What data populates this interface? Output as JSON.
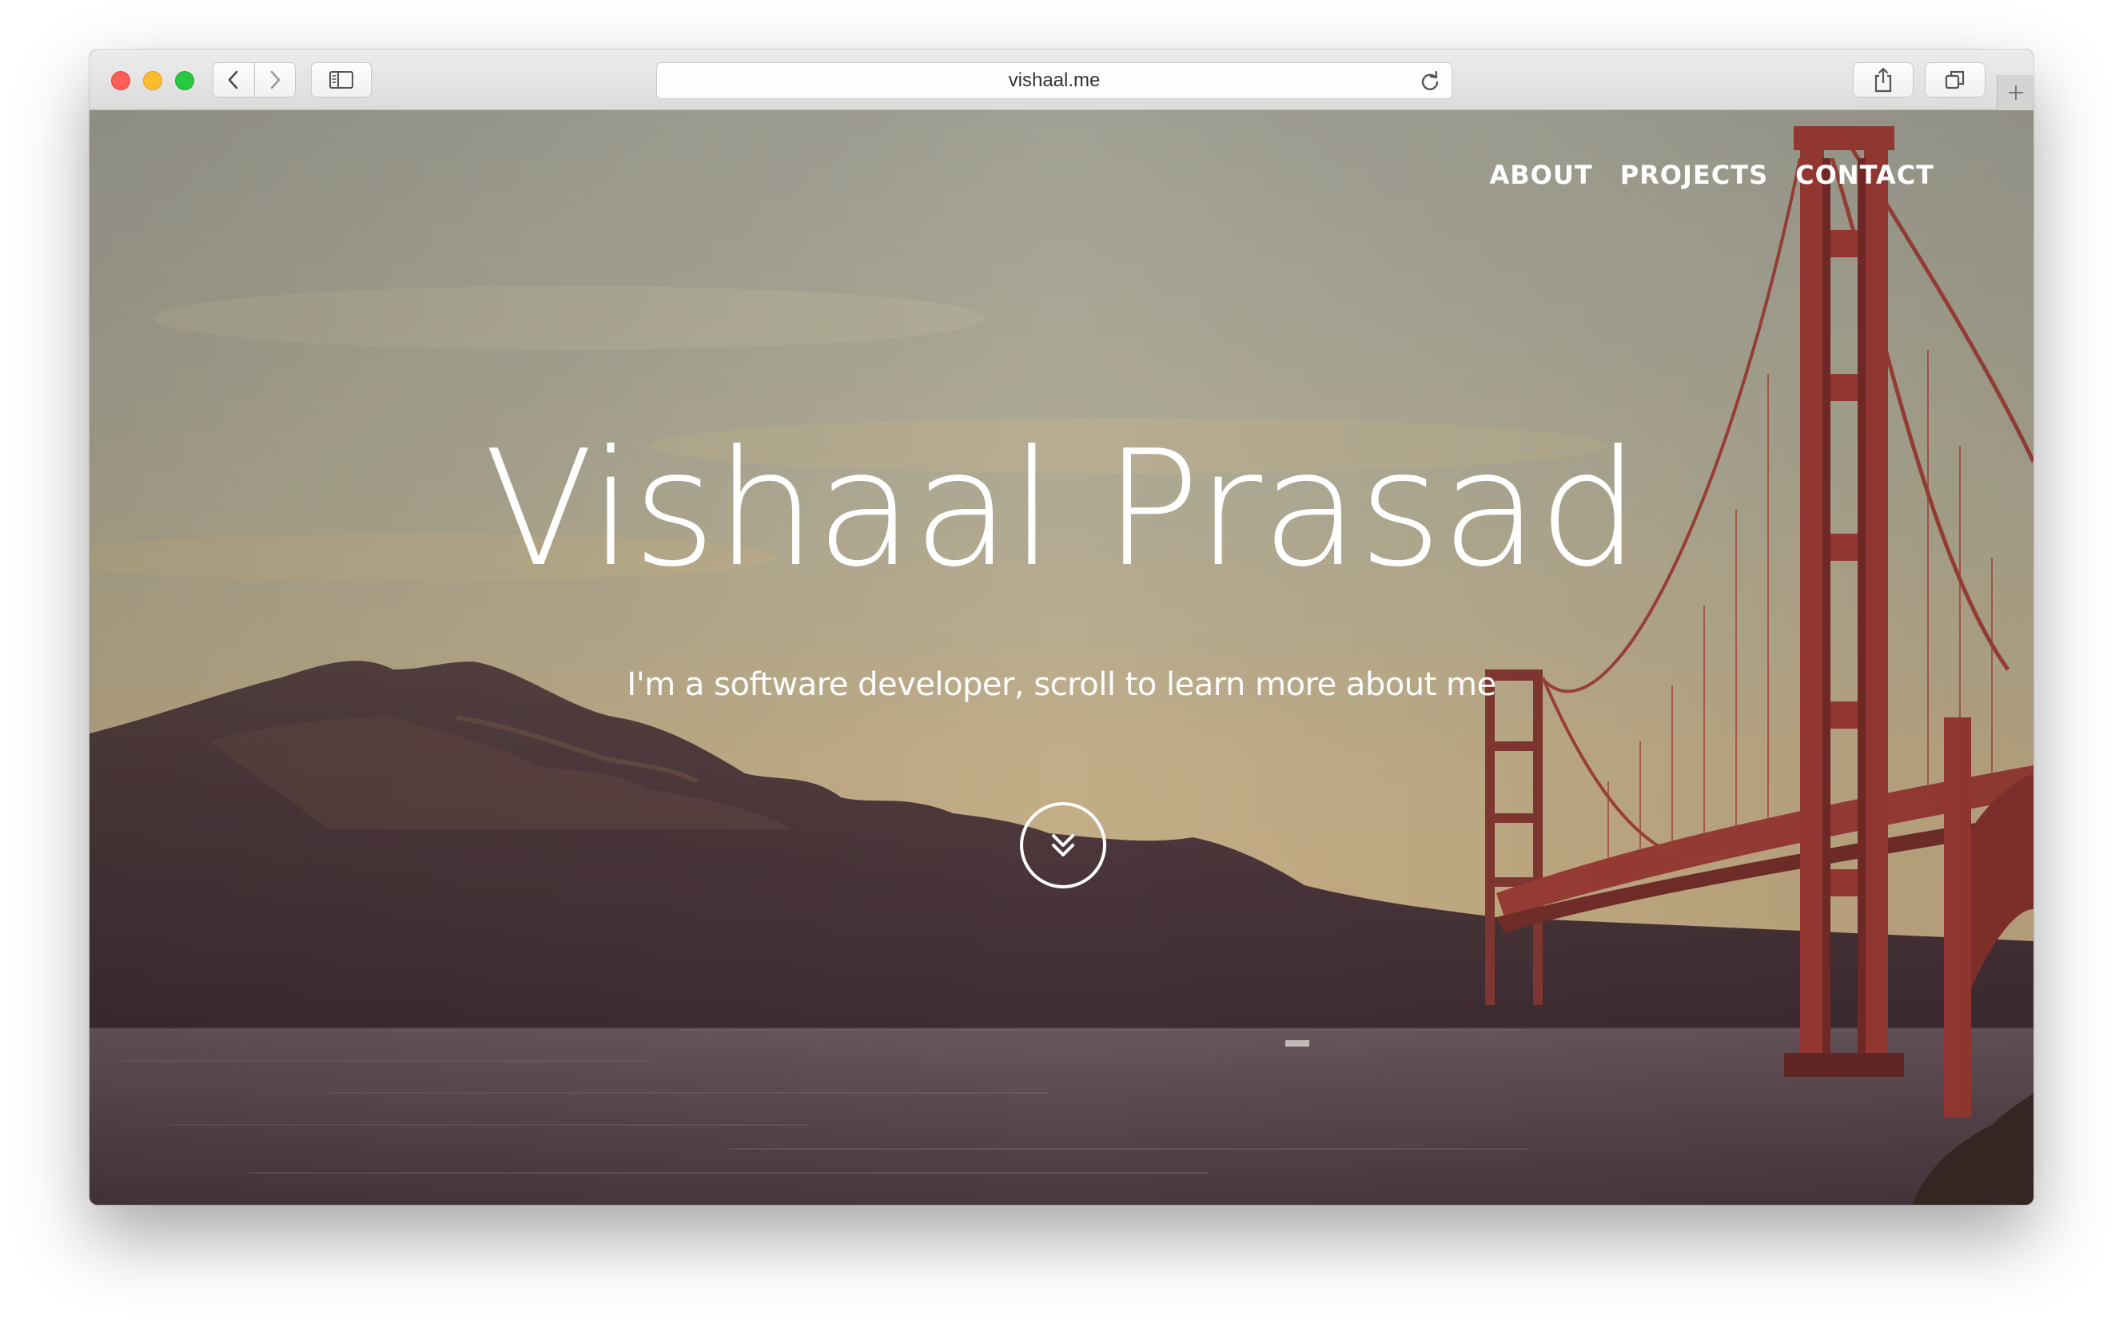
{
  "browser": {
    "url": "vishaal.me"
  },
  "nav": {
    "items": [
      "ABOUT",
      "PROJECTS",
      "CONTACT"
    ]
  },
  "hero": {
    "title": "Vishaal Prasad",
    "subtitle": "I'm a software developer, scroll to learn more about me"
  },
  "icons": {
    "back": "chevron-left-icon",
    "forward": "chevron-right-icon",
    "sidebar": "sidebar-icon",
    "reload": "reload-icon",
    "share": "share-icon",
    "tabs": "tabs-icon",
    "new_tab": "plus-icon",
    "scroll": "double-chevron-down-icon"
  },
  "colors": {
    "accent_bridge": "#b5463c",
    "text": "#ffffff"
  }
}
